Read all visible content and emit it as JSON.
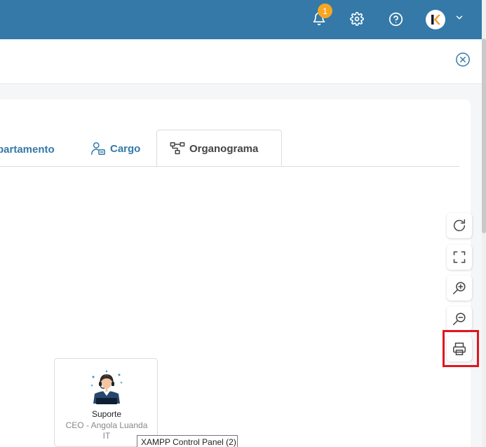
{
  "header": {
    "notification_count": "1",
    "colors": {
      "bar": "#3479a8",
      "badge": "#f5a623"
    }
  },
  "tabs": [
    {
      "label": "partamento",
      "icon": "building-icon"
    },
    {
      "label": "Cargo",
      "icon": "user-badge-icon"
    },
    {
      "label": "Organograma",
      "icon": "org-chart-icon",
      "active": true
    }
  ],
  "toolbar": [
    {
      "name": "refresh-icon"
    },
    {
      "name": "fullscreen-icon"
    },
    {
      "name": "zoom-in-icon"
    },
    {
      "name": "zoom-out-icon"
    },
    {
      "name": "print-icon"
    }
  ],
  "org_node": {
    "name": "Suporte",
    "role_line1": "CEO - Angola Luanda",
    "role_line2": "IT"
  },
  "tooltip": {
    "text": "XAMPP Control Panel (2)"
  },
  "highlight_color": "#e0161e"
}
